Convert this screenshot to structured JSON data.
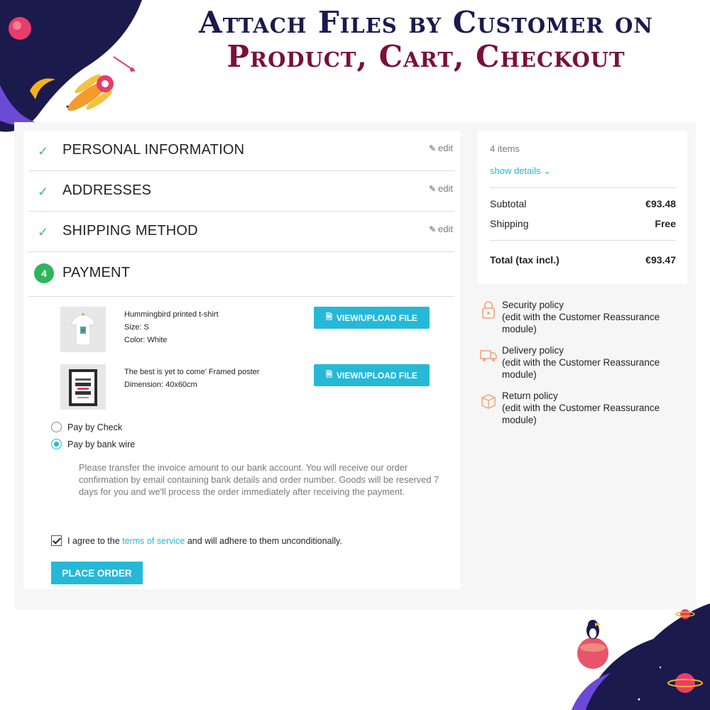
{
  "banner": {
    "line1": "Attach Files by Customer on",
    "line2": "Product, Cart, Checkout"
  },
  "steps": [
    {
      "title": "PERSONAL INFORMATION",
      "edit": "edit",
      "done": true
    },
    {
      "title": "ADDRESSES",
      "edit": "edit",
      "done": true
    },
    {
      "title": "SHIPPING METHOD",
      "edit": "edit",
      "done": true
    },
    {
      "title": "PAYMENT",
      "number": "4",
      "done": false
    }
  ],
  "products": [
    {
      "name": "Hummingbird printed t-shirt",
      "attr1": "Size: S",
      "attr2": "Color: White",
      "button": "VIEW/UPLOAD FILE"
    },
    {
      "name": "The best is yet to come' Framed poster",
      "attr1": "Dimension: 40x60cm",
      "button": "VIEW/UPLOAD FILE"
    }
  ],
  "payment_options": {
    "check": {
      "label": "Pay by Check",
      "selected": false
    },
    "wire": {
      "label": "Pay by bank wire",
      "selected": true
    },
    "wire_text": "Please transfer the invoice amount to our bank account. You will receive our order confirmation by email containing bank details and order number. Goods will be reserved 7 days for you and we'll process the order immediately after receiving the payment."
  },
  "terms": {
    "prefix": "I agree to the",
    "link": "terms of service",
    "suffix": "and will adhere to them unconditionally.",
    "checked": true
  },
  "place_order": "PLACE ORDER",
  "summary": {
    "items": "4 items",
    "show_details": "show details",
    "subtotal_label": "Subtotal",
    "subtotal_value": "€93.48",
    "shipping_label": "Shipping",
    "shipping_value": "Free",
    "total_label": "Total (tax incl.)",
    "total_value": "€93.47"
  },
  "reassurance": [
    {
      "title": "Security policy",
      "desc": "(edit with the Customer Reassurance module)",
      "icon": "lock-icon"
    },
    {
      "title": "Delivery policy",
      "desc": "(edit with the Customer Reassurance module)",
      "icon": "truck-icon"
    },
    {
      "title": "Return policy",
      "desc": "(edit with the Customer Reassurance module)",
      "icon": "return-box-icon"
    }
  ],
  "colors": {
    "accent": "#25b9d7",
    "success": "#2fb55d",
    "banner_dark": "#1b1a4d",
    "banner_red": "#7a0f3c"
  }
}
